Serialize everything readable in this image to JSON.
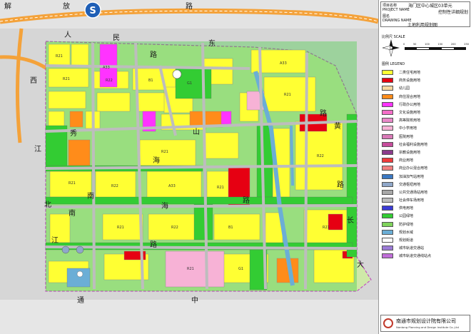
{
  "map": {
    "street_labels": [
      {
        "key": "s1",
        "text": "解"
      },
      {
        "key": "s2",
        "text": "放"
      },
      {
        "key": "s3",
        "text": "路"
      },
      {
        "key": "s4",
        "text": "西"
      },
      {
        "key": "s5",
        "text": "人"
      },
      {
        "key": "s6",
        "text": "民"
      },
      {
        "key": "s7",
        "text": "路"
      },
      {
        "key": "s8",
        "text": "东"
      },
      {
        "key": "s9",
        "text": "秀"
      },
      {
        "key": "s10",
        "text": "山"
      },
      {
        "key": "s11",
        "text": "路"
      },
      {
        "key": "s12",
        "text": "黄"
      },
      {
        "key": "s13",
        "text": "江"
      },
      {
        "key": "s14",
        "text": "海"
      },
      {
        "key": "s15",
        "text": "路"
      },
      {
        "key": "s16",
        "text": "南"
      },
      {
        "key": "s17",
        "text": "南"
      },
      {
        "key": "s18",
        "text": "海"
      },
      {
        "key": "s19",
        "text": "路"
      },
      {
        "key": "s20",
        "text": "北"
      },
      {
        "key": "s21",
        "text": "长"
      },
      {
        "key": "s22",
        "text": "江"
      },
      {
        "key": "s23",
        "text": "路"
      },
      {
        "key": "s24",
        "text": "通"
      },
      {
        "key": "s25",
        "text": "中"
      },
      {
        "key": "s26",
        "text": "大"
      }
    ],
    "metro_badge": "S",
    "parcel_labels": [
      "R21",
      "R21",
      "R22",
      "A33",
      "B1",
      "R21",
      "G1",
      "R21",
      "R22",
      "A33",
      "R21",
      "R21",
      "R22",
      "B1",
      "R21",
      "A33",
      "R21",
      "R22",
      "R21",
      "G1"
    ]
  },
  "title_block": {
    "project_label_cn": "项目名称",
    "project_label_en": "PROJECT NAME",
    "project_name": "海门区中心城区03单元",
    "project_subname": "控制性详细规划",
    "drawing_label_cn": "图名",
    "drawing_label_en": "DRAWING NAME",
    "drawing_name": "土地利用规划图"
  },
  "scale": {
    "title": "比例尺 SCALE",
    "ticks": [
      "0",
      "50",
      "100",
      "150",
      "200",
      "250"
    ]
  },
  "legend": {
    "title": "图例 LEGEND",
    "items": [
      {
        "label": "二类住宅用地",
        "color": "#ffff33"
      },
      {
        "label": "商务设施用地",
        "color": "#e60012"
      },
      {
        "label": "幼儿园",
        "color": "#f5d6a0"
      },
      {
        "label": "商住混合用地",
        "color": "#ff8c1a"
      },
      {
        "label": "行政办公用地",
        "color": "#ff33ff"
      },
      {
        "label": "文化设施用地",
        "color": "#f46ec8"
      },
      {
        "label": "高等院校用地",
        "color": "#e989c9"
      },
      {
        "label": "中小学用地",
        "color": "#f7b2d6"
      },
      {
        "label": "医院用地",
        "color": "#d97ab8"
      },
      {
        "label": "社会福利设施用地",
        "color": "#c64c9c"
      },
      {
        "label": "宗教设施用地",
        "color": "#8a3c8c"
      },
      {
        "label": "商业用地",
        "color": "#ef3b3b"
      },
      {
        "label": "商业办公混合用地",
        "color": "#f08080"
      },
      {
        "label": "加油加气站用地",
        "color": "#3a78c2"
      },
      {
        "label": "交通枢纽用地",
        "color": "#8fa7c9"
      },
      {
        "label": "公共交通场站用地",
        "color": "#a9a9a9"
      },
      {
        "label": "社会停车场用地",
        "color": "#bdbdbd"
      },
      {
        "label": "供电用地",
        "color": "#3b3bd6"
      },
      {
        "label": "公园绿地",
        "color": "#33cc33"
      },
      {
        "label": "防护绿地",
        "color": "#7fd35b"
      },
      {
        "label": "规划水域",
        "color": "#6baed6"
      },
      {
        "label": "规划街道",
        "color": "#ffffff"
      },
      {
        "label": "城市轨道交通站",
        "color": "#9b7bd6"
      },
      {
        "label": "城市轨道交通线站点",
        "color": "#c06fd8"
      }
    ]
  },
  "company": {
    "name": "南通市规划设计院有限公司",
    "name_en": "Nantong Planning and Design Institute Co.,Ltd"
  }
}
